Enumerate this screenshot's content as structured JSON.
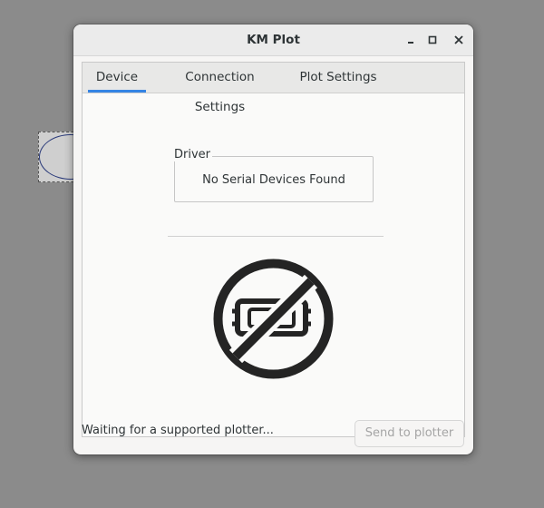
{
  "window": {
    "title": "KM Plot"
  },
  "tabs": [
    {
      "label": "Device",
      "active": true
    },
    {
      "label": "Connection Settings",
      "active": false
    },
    {
      "label": "Plot Settings",
      "active": false
    }
  ],
  "device": {
    "driver_label": "Driver",
    "driver_value": "No Serial Devices Found",
    "status_icon": "no-device-icon"
  },
  "footer": {
    "status_text": "Waiting for a supported plotter...",
    "send_button": "Send to plotter",
    "send_enabled": false
  },
  "colors": {
    "accent": "#3584e4",
    "icon": "#242424"
  }
}
